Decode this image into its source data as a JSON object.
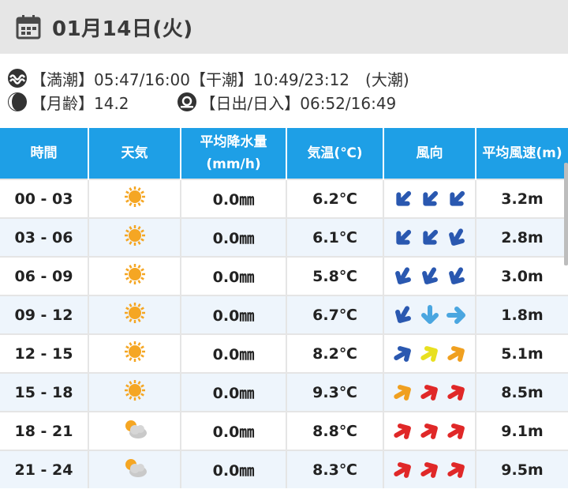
{
  "header": {
    "date": "01月14日(火)",
    "icon": "calendar-icon"
  },
  "info": {
    "tide": "【満潮】05:47/16:00【干潮】10:49/23:12　(大潮)",
    "moon": "【月齢】14.2",
    "sun": "【日出/日入】06:52/16:49"
  },
  "table": {
    "headers": [
      "時間",
      "天気",
      "平均降水量\n(mm/h)",
      "気温(℃)",
      "風向",
      "平均風速(m)"
    ],
    "rows": [
      {
        "time": "00 - 03",
        "weather": "sunny",
        "precip": "0.0㎜",
        "temp": "6.2℃",
        "wind": [
          {
            "angle": 225,
            "color": "#2a58b0"
          },
          {
            "angle": 225,
            "color": "#2a58b0"
          },
          {
            "angle": 225,
            "color": "#2a58b0"
          }
        ],
        "speed": "3.2m"
      },
      {
        "time": "03 - 06",
        "weather": "sunny",
        "precip": "0.0㎜",
        "temp": "6.1℃",
        "wind": [
          {
            "angle": 225,
            "color": "#2a58b0"
          },
          {
            "angle": 225,
            "color": "#2a58b0"
          },
          {
            "angle": 210,
            "color": "#2a58b0"
          }
        ],
        "speed": "2.8m"
      },
      {
        "time": "06 - 09",
        "weather": "sunny",
        "precip": "0.0㎜",
        "temp": "5.8℃",
        "wind": [
          {
            "angle": 210,
            "color": "#2a58b0"
          },
          {
            "angle": 210,
            "color": "#2a58b0"
          },
          {
            "angle": 210,
            "color": "#2a58b0"
          }
        ],
        "speed": "3.0m"
      },
      {
        "time": "09 - 12",
        "weather": "sunny",
        "precip": "0.0㎜",
        "temp": "6.7℃",
        "wind": [
          {
            "angle": 210,
            "color": "#2a58b0"
          },
          {
            "angle": 180,
            "color": "#4aa6e0"
          },
          {
            "angle": 90,
            "color": "#4aa6e0"
          }
        ],
        "speed": "1.8m"
      },
      {
        "time": "12 - 15",
        "weather": "sunny",
        "precip": "0.0㎜",
        "temp": "8.2℃",
        "wind": [
          {
            "angle": 60,
            "color": "#2a58b0"
          },
          {
            "angle": 60,
            "color": "#e8e020"
          },
          {
            "angle": 60,
            "color": "#f0a020"
          }
        ],
        "speed": "5.1m"
      },
      {
        "time": "15 - 18",
        "weather": "sunny",
        "precip": "0.0㎜",
        "temp": "9.3℃",
        "wind": [
          {
            "angle": 60,
            "color": "#f0a020"
          },
          {
            "angle": 60,
            "color": "#e02828"
          },
          {
            "angle": 60,
            "color": "#e02828"
          }
        ],
        "speed": "8.5m"
      },
      {
        "time": "18 - 21",
        "weather": "sun-cloud",
        "precip": "0.0㎜",
        "temp": "8.8℃",
        "wind": [
          {
            "angle": 60,
            "color": "#e02828"
          },
          {
            "angle": 60,
            "color": "#e02828"
          },
          {
            "angle": 60,
            "color": "#e02828"
          }
        ],
        "speed": "9.1m"
      },
      {
        "time": "21 - 24",
        "weather": "sun-cloud",
        "precip": "0.0㎜",
        "temp": "8.3℃",
        "wind": [
          {
            "angle": 60,
            "color": "#e02828"
          },
          {
            "angle": 60,
            "color": "#e02828"
          },
          {
            "angle": 60,
            "color": "#e02828"
          }
        ],
        "speed": "9.5m"
      }
    ]
  },
  "colors": {
    "header_bg": "#1e9fe6",
    "alt_row": "#eef5fc"
  }
}
